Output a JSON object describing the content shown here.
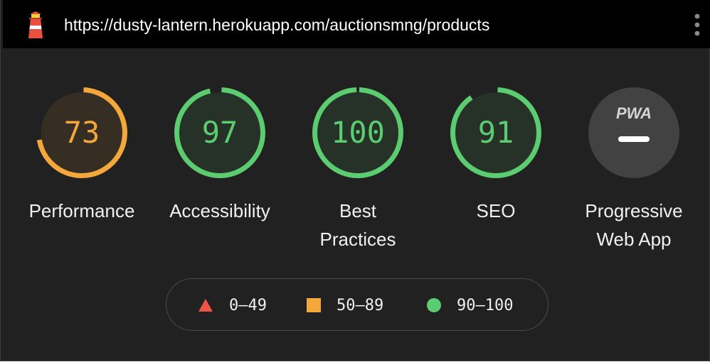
{
  "header": {
    "url": "https://dusty-lantern.herokuapp.com/auctionsmng/products",
    "logo_icon": "lighthouse-icon",
    "menu_icon": "vertical-dots-icon"
  },
  "categories": [
    {
      "label": "Performance",
      "score": 73,
      "status": "average",
      "color": "#f4a83b",
      "fraction": 0.73
    },
    {
      "label": "Accessibility",
      "score": 97,
      "status": "pass",
      "color": "#5bcd70",
      "fraction": 0.97
    },
    {
      "label": "Best Practices",
      "label_lines": [
        "Best",
        "Practices"
      ],
      "score": 100,
      "status": "pass",
      "color": "#5bcd70",
      "fraction": 1.0
    },
    {
      "label": "SEO",
      "score": 91,
      "status": "pass",
      "color": "#5bcd70",
      "fraction": 0.91
    }
  ],
  "pwa": {
    "badge": "PWA",
    "label_lines": [
      "Progressive",
      "Web App"
    ],
    "score_icon": "dash-icon"
  },
  "legend": [
    {
      "range": "0–49",
      "shape": "triangle",
      "color": "#ec5546"
    },
    {
      "range": "50–89",
      "shape": "square",
      "color": "#f4a83b"
    },
    {
      "range": "90–100",
      "shape": "circle",
      "color": "#5bcd70"
    }
  ]
}
